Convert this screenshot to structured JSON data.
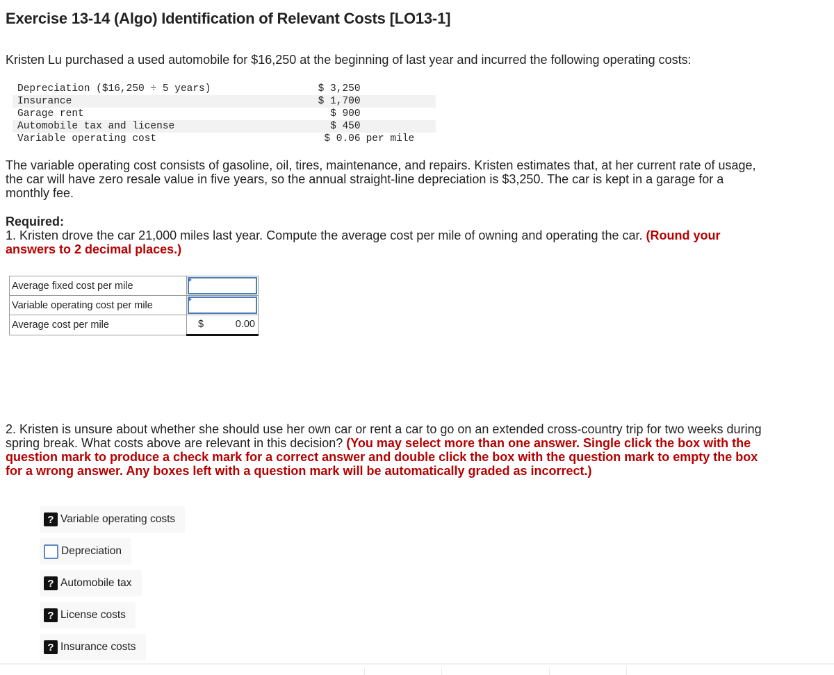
{
  "title": "Exercise 13-14 (Algo) Identification of Relevant Costs [LO13-1]",
  "intro": "Kristen Lu purchased a used automobile for $16,250 at the beginning of last year and incurred the following operating costs:",
  "costs": [
    {
      "label": "Depreciation ($16,250 ÷ 5 years)",
      "amount": "$ 3,250",
      "unit": ""
    },
    {
      "label": "Insurance",
      "amount": "$ 1,700",
      "unit": ""
    },
    {
      "label": "Garage rent",
      "amount": "$ 900",
      "unit": ""
    },
    {
      "label": "Automobile tax and license",
      "amount": "$ 450",
      "unit": ""
    },
    {
      "label": "Variable operating cost",
      "amount": "$ 0.06",
      "unit": "per mile"
    }
  ],
  "description": "The variable operating cost consists of gasoline, oil, tires, maintenance, and repairs. Kristen estimates that, at her current rate of usage, the car will have zero resale value in five years, so the annual straight-line depreciation is $3,250. The car is kept in a garage for a monthly fee.",
  "required": {
    "heading": "Required:",
    "q1_text": "1. Kristen drove the car 21,000 miles last year. Compute the average cost per mile of owning and operating the car. ",
    "q1_note": "(Round your answers to 2 decimal places.)"
  },
  "answer_table": {
    "rows": [
      {
        "label": "Average fixed cost per mile",
        "value": ""
      },
      {
        "label": "Variable operating cost per mile",
        "value": ""
      },
      {
        "label": "Average cost per mile",
        "currency": "$",
        "value": "0.00"
      }
    ]
  },
  "q2": {
    "text": "2. Kristen is unsure about whether she should use her own car or rent a car to go on an extended cross-country trip for two weeks during spring break. What costs above are relevant in this decision? ",
    "note": "(You may select more than one answer. Single click the box with the question mark to produce a check mark for a correct answer and double click the box with the question mark to empty the box for a wrong answer. Any boxes left with a question mark will be automatically graded as incorrect.)",
    "choices": [
      {
        "label": "Variable operating costs",
        "state": "question",
        "glyph": "?"
      },
      {
        "label": "Depreciation",
        "state": "empty",
        "glyph": ""
      },
      {
        "label": "Automobile tax",
        "state": "question",
        "glyph": "?"
      },
      {
        "label": "License costs",
        "state": "question",
        "glyph": "?"
      },
      {
        "label": "Insurance costs",
        "state": "question",
        "glyph": "?"
      }
    ]
  }
}
